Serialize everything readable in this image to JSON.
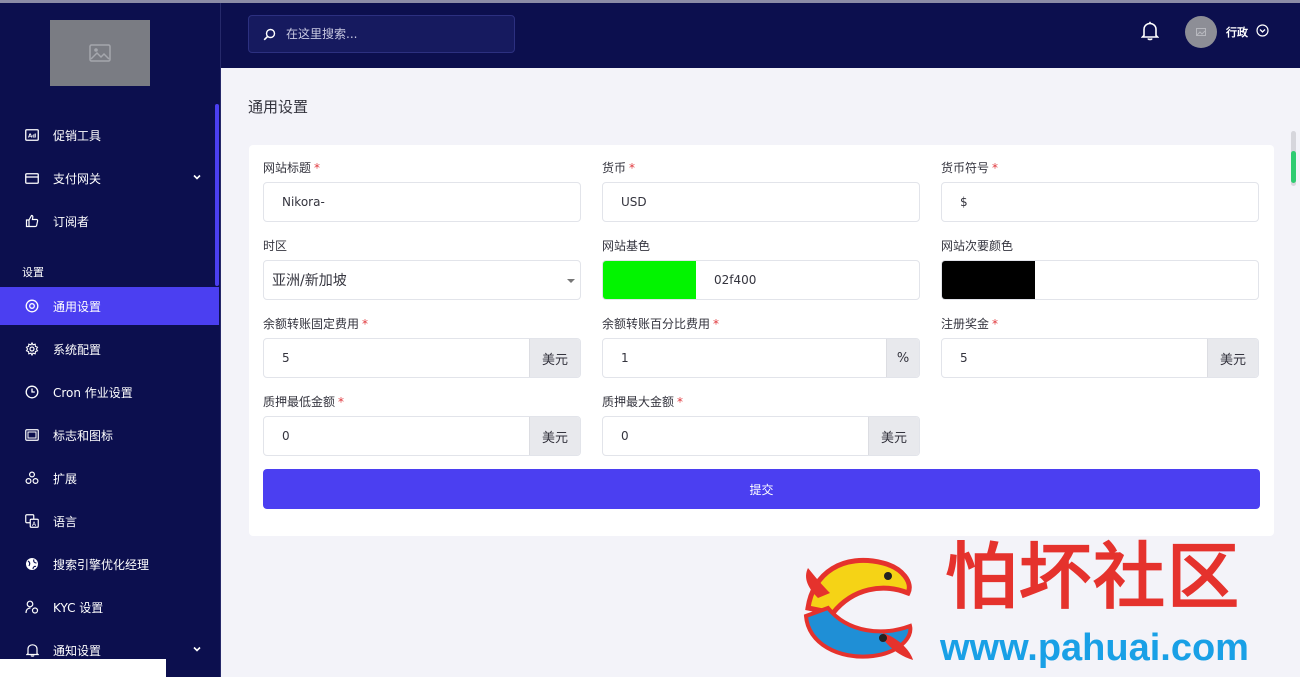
{
  "header": {
    "search_placeholder": "在这里搜索...",
    "user_name": "行政"
  },
  "sidebar": {
    "section_label": "设置",
    "items": [
      {
        "label": "促销工具"
      },
      {
        "label": "支付网关"
      },
      {
        "label": "订阅者"
      },
      {
        "label": "通用设置"
      },
      {
        "label": "系统配置"
      },
      {
        "label": "Cron 作业设置"
      },
      {
        "label": "标志和图标"
      },
      {
        "label": "扩展"
      },
      {
        "label": "语言"
      },
      {
        "label": "搜索引擎优化经理"
      },
      {
        "label": "KYC 设置"
      },
      {
        "label": "通知设置"
      }
    ]
  },
  "page": {
    "title": "通用设置"
  },
  "form": {
    "site_title": {
      "label": "网站标题",
      "value": "Nikora-"
    },
    "currency": {
      "label": "货币",
      "value": "USD"
    },
    "currency_symbol": {
      "label": "货币符号",
      "value": "$"
    },
    "timezone": {
      "label": "时区",
      "value": "亚洲/新加坡"
    },
    "base_color": {
      "label": "网站基色",
      "value": "02f400",
      "swatch": "#02f400"
    },
    "secondary_color": {
      "label": "网站次要颜色",
      "value": "",
      "swatch": "#000000"
    },
    "transfer_fixed_fee": {
      "label": "余额转账固定费用",
      "value": "5",
      "addon": "美元"
    },
    "transfer_percent_fee": {
      "label": "余额转账百分比费用",
      "value": "1",
      "addon": "%"
    },
    "signup_bonus": {
      "label": "注册奖金",
      "value": "5",
      "addon": "美元"
    },
    "stake_min": {
      "label": "质押最低金额",
      "value": "0",
      "addon": "美元"
    },
    "stake_max": {
      "label": "质押最大金额",
      "value": "0",
      "addon": "美元"
    },
    "required_mark": "*",
    "submit_label": "提交"
  },
  "watermark": {
    "text": "怕坏社区",
    "url": "www.pahuai.com"
  },
  "colors": {
    "sidebar_bg": "#0c0f4e",
    "accent": "#4b3ff1",
    "required": "#e0393e"
  }
}
